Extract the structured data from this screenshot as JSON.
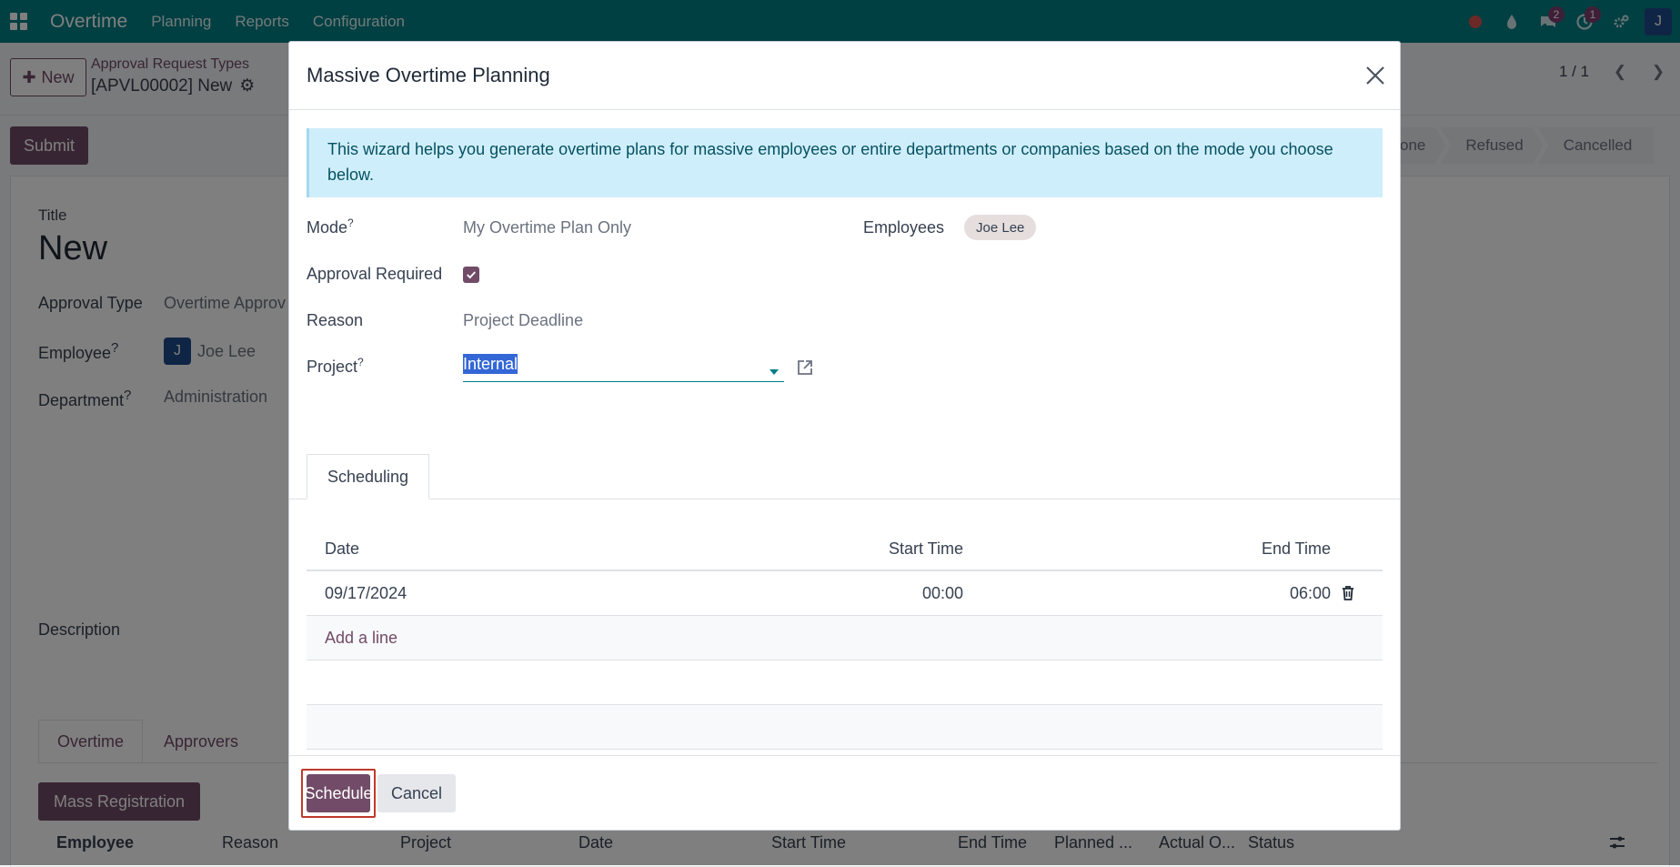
{
  "navbar": {
    "app_name": "Overtime",
    "menus": [
      "Planning",
      "Reports",
      "Configuration"
    ],
    "messages_badge": "2",
    "activities_badge": "1",
    "user_initial": "J",
    "brand_color": "#017e84"
  },
  "control_panel": {
    "new_label": "New",
    "breadcrumb_parent": "Approval Request Types",
    "breadcrumb_current": "[APVL00002] New",
    "pager": "1 / 1",
    "submit_label": "Submit",
    "status_steps": [
      "Done",
      "Refused",
      "Cancelled"
    ],
    "status_first_visible": "one"
  },
  "form": {
    "title_label": "Title",
    "title_value": "New",
    "approval_type_label": "Approval Type",
    "approval_type_value": "Overtime Approv",
    "employee_label": "Employee",
    "employee_initial": "J",
    "employee_value": "Joe Lee",
    "department_label": "Department",
    "department_value": "Administration",
    "description_label": "Description",
    "tabs": [
      "Overtime",
      "Approvers"
    ],
    "mass_registration_label": "Mass Registration",
    "columns": [
      "Employee",
      "Reason",
      "Project",
      "Date",
      "Start Time",
      "End Time",
      "Planned ...",
      "Actual O...",
      "Status"
    ]
  },
  "modal": {
    "title": "Massive Overtime Planning",
    "info_text": "This wizard helps you generate overtime plans for massive employees or entire departments or companies based on the mode you choose below.",
    "mode_label": "Mode",
    "mode_value": "My Overtime Plan Only",
    "employees_label": "Employees",
    "employees_tag": "Joe Lee",
    "approval_required_label": "Approval Required",
    "approval_required_checked": true,
    "reason_label": "Reason",
    "reason_value": "Project Deadline",
    "project_label": "Project",
    "project_value": "Internal",
    "help_mark": "?",
    "tab_label": "Scheduling",
    "table": {
      "headers": {
        "date": "Date",
        "start": "Start Time",
        "end": "End Time"
      },
      "rows": [
        {
          "date": "09/17/2024",
          "start": "00:00",
          "end": "06:00"
        }
      ],
      "add_line_label": "Add a line"
    },
    "schedule_label": "Schedule",
    "cancel_label": "Cancel"
  }
}
